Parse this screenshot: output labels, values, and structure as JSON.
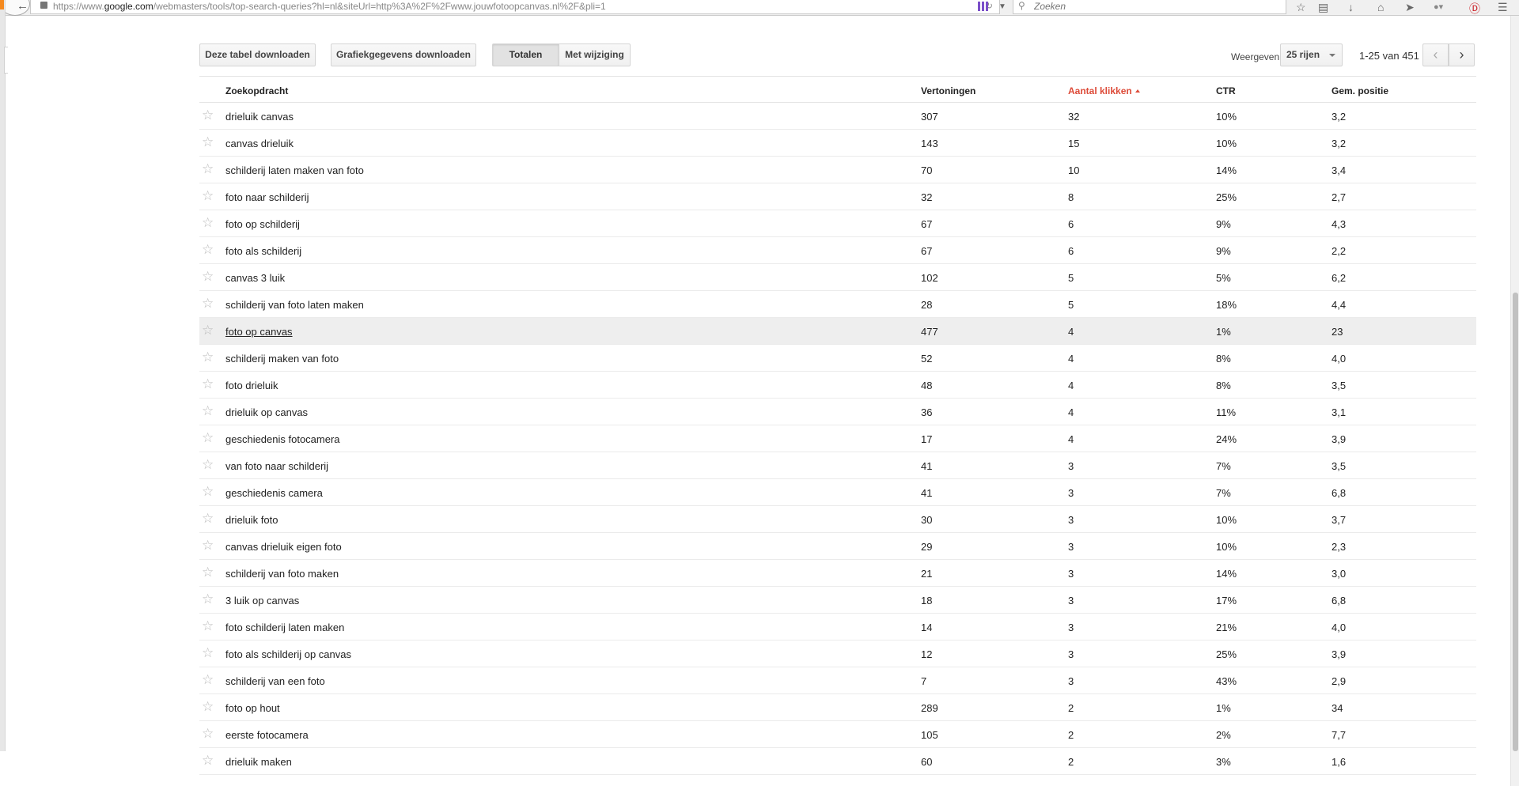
{
  "browser": {
    "url_prefix": "https://www.",
    "url_domain": "google.com",
    "url_rest": "/webmasters/tools/top-search-queries?hl=nl&siteUrl=http%3A%2F%2Fwww.jouwfotoopcanvas.nl%2F&pli=1",
    "search_placeholder": "Zoeken"
  },
  "toolbar": {
    "download_table": "Deze tabel downloaden",
    "download_chart": "Grafiekgegevens downloaden",
    "totals": "Totalen",
    "with_change": "Met wijziging",
    "show_label": "Weergeven",
    "rows_select": "25 rijen",
    "page_range": "1-25 van 451"
  },
  "table": {
    "headers": {
      "query": "Zoekopdracht",
      "impressions": "Vertoningen",
      "clicks": "Aantal klikken",
      "ctr": "CTR",
      "position": "Gem. positie"
    },
    "rows": [
      {
        "query": "drieluik canvas",
        "impressions": "307",
        "clicks": "32",
        "ctr": "10%",
        "position": "3,2"
      },
      {
        "query": "canvas drieluik",
        "impressions": "143",
        "clicks": "15",
        "ctr": "10%",
        "position": "3,2"
      },
      {
        "query": "schilderij laten maken van foto",
        "impressions": "70",
        "clicks": "10",
        "ctr": "14%",
        "position": "3,4"
      },
      {
        "query": "foto naar schilderij",
        "impressions": "32",
        "clicks": "8",
        "ctr": "25%",
        "position": "2,7"
      },
      {
        "query": "foto op schilderij",
        "impressions": "67",
        "clicks": "6",
        "ctr": "9%",
        "position": "4,3"
      },
      {
        "query": "foto als schilderij",
        "impressions": "67",
        "clicks": "6",
        "ctr": "9%",
        "position": "2,2"
      },
      {
        "query": "canvas 3 luik",
        "impressions": "102",
        "clicks": "5",
        "ctr": "5%",
        "position": "6,2"
      },
      {
        "query": "schilderij van foto laten maken",
        "impressions": "28",
        "clicks": "5",
        "ctr": "18%",
        "position": "4,4"
      },
      {
        "query": "foto op canvas",
        "impressions": "477",
        "clicks": "4",
        "ctr": "1%",
        "position": "23"
      },
      {
        "query": "schilderij maken van foto",
        "impressions": "52",
        "clicks": "4",
        "ctr": "8%",
        "position": "4,0"
      },
      {
        "query": "foto drieluik",
        "impressions": "48",
        "clicks": "4",
        "ctr": "8%",
        "position": "3,5"
      },
      {
        "query": "drieluik op canvas",
        "impressions": "36",
        "clicks": "4",
        "ctr": "11%",
        "position": "3,1"
      },
      {
        "query": "geschiedenis fotocamera",
        "impressions": "17",
        "clicks": "4",
        "ctr": "24%",
        "position": "3,9"
      },
      {
        "query": "van foto naar schilderij",
        "impressions": "41",
        "clicks": "3",
        "ctr": "7%",
        "position": "3,5"
      },
      {
        "query": "geschiedenis camera",
        "impressions": "41",
        "clicks": "3",
        "ctr": "7%",
        "position": "6,8"
      },
      {
        "query": "drieluik foto",
        "impressions": "30",
        "clicks": "3",
        "ctr": "10%",
        "position": "3,7"
      },
      {
        "query": "canvas drieluik eigen foto",
        "impressions": "29",
        "clicks": "3",
        "ctr": "10%",
        "position": "2,3"
      },
      {
        "query": "schilderij van foto maken",
        "impressions": "21",
        "clicks": "3",
        "ctr": "14%",
        "position": "3,0"
      },
      {
        "query": "3 luik op canvas",
        "impressions": "18",
        "clicks": "3",
        "ctr": "17%",
        "position": "6,8"
      },
      {
        "query": "foto schilderij laten maken",
        "impressions": "14",
        "clicks": "3",
        "ctr": "21%",
        "position": "4,0"
      },
      {
        "query": "foto als schilderij op canvas",
        "impressions": "12",
        "clicks": "3",
        "ctr": "25%",
        "position": "3,9"
      },
      {
        "query": "schilderij van een foto",
        "impressions": "7",
        "clicks": "3",
        "ctr": "43%",
        "position": "2,9"
      },
      {
        "query": "foto op hout",
        "impressions": "289",
        "clicks": "2",
        "ctr": "1%",
        "position": "34"
      },
      {
        "query": "eerste fotocamera",
        "impressions": "105",
        "clicks": "2",
        "ctr": "2%",
        "position": "7,7"
      },
      {
        "query": "drieluik maken",
        "impressions": "60",
        "clicks": "2",
        "ctr": "3%",
        "position": "1,6"
      }
    ]
  },
  "hovered_row_index": 8,
  "colors": {
    "sort_accent": "#dd4b39",
    "hover_row": "#eeeeee"
  }
}
